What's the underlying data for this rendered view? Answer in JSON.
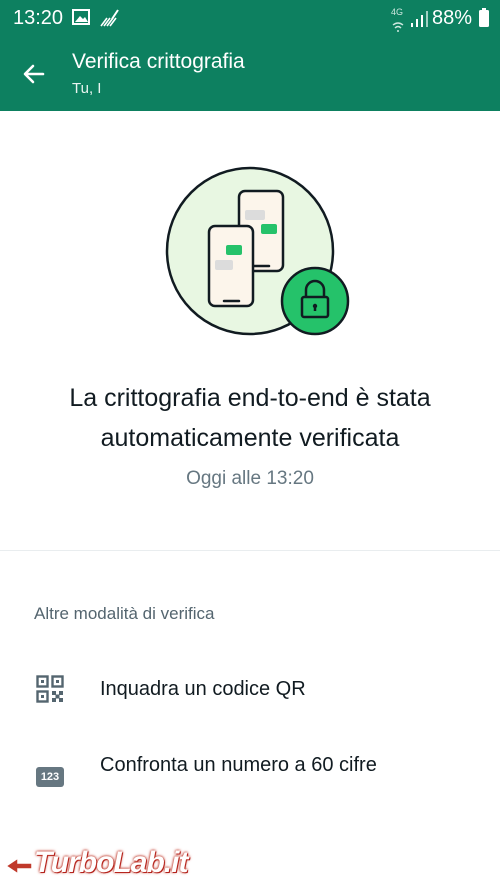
{
  "status_bar": {
    "time": "13:20",
    "network": "4G",
    "battery": "88%"
  },
  "header": {
    "title": "Verifica crittografia",
    "subtitle": "Tu, I"
  },
  "main": {
    "headline": "La crittografia end-to-end è stata automaticamente verificata",
    "timestamp": "Oggi alle 13:20"
  },
  "other_methods": {
    "label": "Altre modalità di verifica",
    "options": [
      {
        "label": "Inquadra un codice QR",
        "icon": "qr-code-icon"
      },
      {
        "label": "Confronta un numero a 60 cifre",
        "icon": "numeric-123-icon",
        "icon_text": "123"
      }
    ]
  },
  "watermark": {
    "text": "TurboLab.it"
  },
  "colors": {
    "brand": "#0d8060",
    "accent_green": "#25c26a",
    "hero_bg": "#e8f7e2"
  }
}
